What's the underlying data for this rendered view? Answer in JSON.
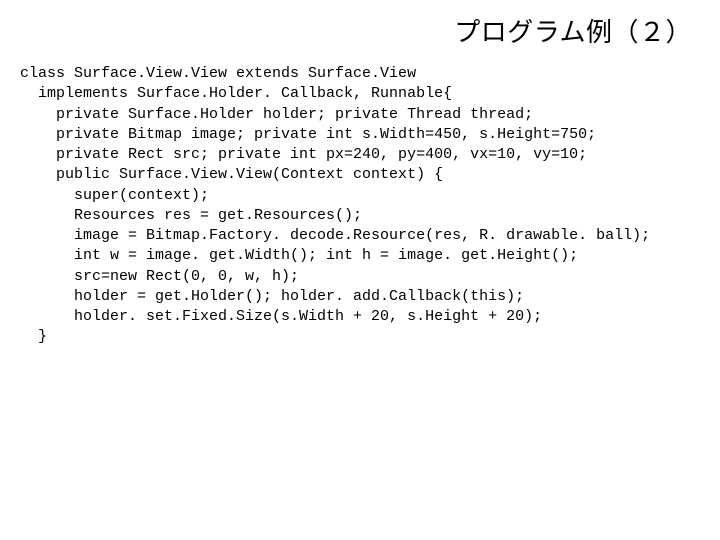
{
  "title": "プログラム例（２）",
  "code": "class Surface.View.View extends Surface.View\n  implements Surface.Holder. Callback, Runnable{\n    private Surface.Holder holder; private Thread thread;\n    private Bitmap image; private int s.Width=450, s.Height=750;\n    private Rect src; private int px=240, py=400, vx=10, vy=10;\n    public Surface.View.View(Context context) {\n      super(context);\n      Resources res = get.Resources();\n      image = Bitmap.Factory. decode.Resource(res, R. drawable. ball);\n      int w = image. get.Width(); int h = image. get.Height();\n      src=new Rect(0, 0, w, h);\n      holder = get.Holder(); holder. add.Callback(this);\n      holder. set.Fixed.Size(s.Width + 20, s.Height + 20);\n  }"
}
